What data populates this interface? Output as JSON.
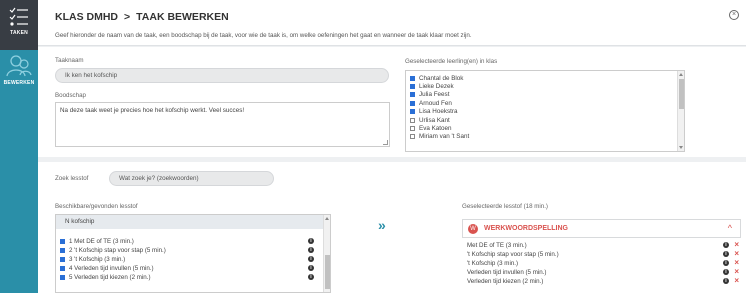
{
  "sidebar": {
    "items": [
      {
        "label": "TAKEN",
        "icon": "task-list-icon"
      },
      {
        "label": "BEWERKEN",
        "icon": "users-icon"
      }
    ]
  },
  "header": {
    "class_name": "KLAS DMHD",
    "separator": ">",
    "page_title": "TAAK BEWERKEN",
    "instruction": "Geef hieronder de naam van de taak, een boodschap bij de taak, voor wie de taak is, om welke oefeningen het gaat en wanneer de taak klaar moet zijn."
  },
  "form": {
    "taskname_label": "Taaknaam",
    "taskname_value": "Ik ken het kofschip",
    "message_label": "Boodschap",
    "message_value": "Na deze taak weet je precies hoe het kofschip werkt. Veel succes!",
    "students_label": "Geselecteerde leerling(en) in klas",
    "students": [
      {
        "name": "Chantal de Blok",
        "checked": true
      },
      {
        "name": "Lieke Dezek",
        "checked": true
      },
      {
        "name": "Julia Feest",
        "checked": true
      },
      {
        "name": "Arnoud Fen",
        "checked": true
      },
      {
        "name": "Lisa Hoekstra",
        "checked": true
      },
      {
        "name": "Urlisa Kant",
        "checked": false
      },
      {
        "name": "Eva Katoen",
        "checked": false
      },
      {
        "name": "Miriam van 't Sant",
        "checked": false
      }
    ]
  },
  "lesstof": {
    "search_label": "Zoek lesstof",
    "search_placeholder": "Wat zoek je? (zoekwoorden)",
    "available_label": "Beschikbare/gevonden lesstof",
    "available_group": "N kofschip",
    "available_items": [
      {
        "label": "1 Met DE of TE (3 min.)",
        "checked": true
      },
      {
        "label": "2 't Kofschip stap voor stap (5 min.)",
        "checked": true
      },
      {
        "label": "3 't Kofschip (3 min.)",
        "checked": true
      },
      {
        "label": "4 Verleden tijd invullen (5 min.)",
        "checked": true
      },
      {
        "label": "5 Verleden tijd kiezen (2 min.)",
        "checked": true
      }
    ],
    "move_label": "»",
    "selected_label": "Geselecteerde lesstof (18 min.)",
    "category": {
      "badge": "W",
      "name": "WERKWOORDSPELLING",
      "color": "#d9534f"
    },
    "selected_items": [
      "Met DE of TE (3 min.)",
      "'t Kofschip stap voor stap (5 min.)",
      "'t Kofschip (3 min.)",
      "Verleden tijd invullen (5 min.)",
      "Verleden tijd kiezen (2 min.)"
    ]
  },
  "colors": {
    "accent": "#2a8fa8",
    "sidebar_dark": "#383d44",
    "danger": "#d9534f"
  }
}
